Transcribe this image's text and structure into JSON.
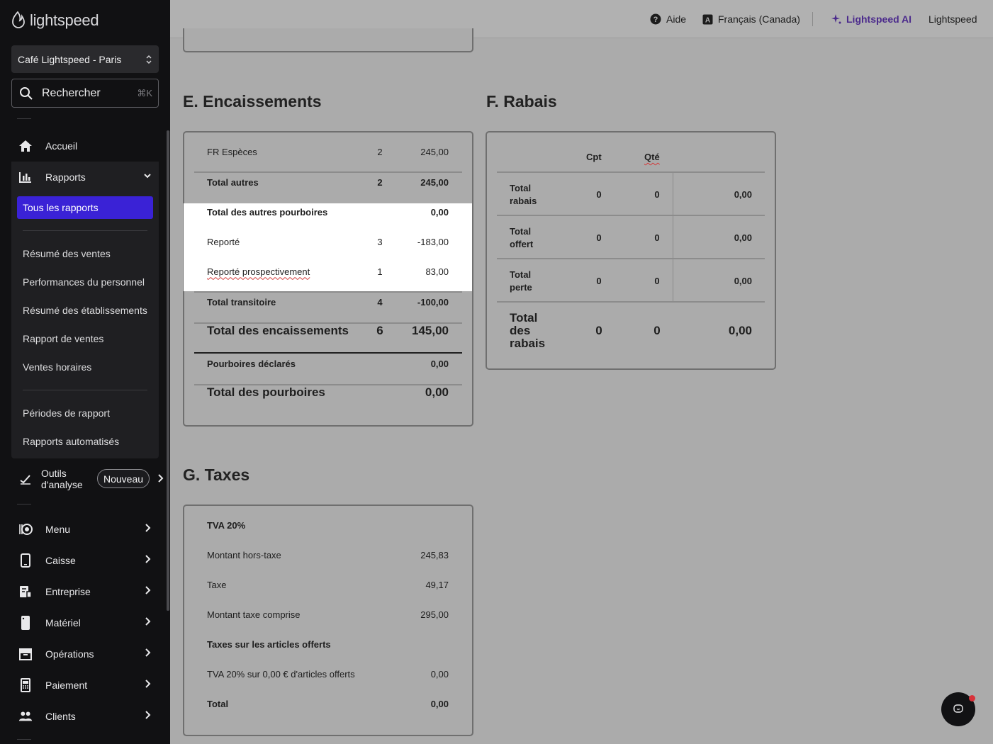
{
  "sidebar": {
    "logo_text": "lightspeed",
    "venue": "Café Lightspeed - Paris",
    "search": {
      "label": "Rechercher",
      "shortcut": "⌘K"
    },
    "nav": {
      "accueil": "Accueil",
      "rapports": "Rapports",
      "outils": "Outils d'analyse",
      "outils_badge": "Nouveau",
      "menu": "Menu",
      "caisse": "Caisse",
      "entreprise": "Entreprise",
      "materiel": "Matériel",
      "operations": "Opérations",
      "paiement": "Paiement",
      "clients": "Clients"
    },
    "reports_sub": {
      "active": "Tous les rapports",
      "items": [
        "Résumé des ventes",
        "Performances du personnel",
        "Résumé des établissements",
        "Rapport de ventes",
        "Ventes horaires"
      ],
      "items2": [
        "Périodes de rapport",
        "Rapports automatisés"
      ]
    }
  },
  "topbar": {
    "help": "Aide",
    "language": "Français (Canada)",
    "ai": "Lightspeed AI",
    "account": "Lightspeed"
  },
  "encaissements": {
    "title": "E. Encaissements",
    "rows": [
      {
        "label": "FR Espèces",
        "count": "2",
        "amount": "245,00"
      },
      {
        "label": "Total autres",
        "count": "2",
        "amount": "245,00"
      },
      {
        "label": "Total des autres pourboires",
        "count": "",
        "amount": "0,00"
      },
      {
        "label": "Reporté",
        "count": "3",
        "amount": "-183,00"
      },
      {
        "label": "Reporté prospectivement",
        "count": "1",
        "amount": "83,00"
      },
      {
        "label": "Total transitoire",
        "count": "4",
        "amount": "-100,00"
      },
      {
        "label": "Total des encaissements",
        "count": "6",
        "amount": "145,00"
      },
      {
        "label": "Pourboires déclarés",
        "count": "",
        "amount": "0,00"
      },
      {
        "label": "Total des pourboires",
        "count": "",
        "amount": "0,00"
      }
    ]
  },
  "rabais": {
    "title": "F. Rabais",
    "headers": {
      "cpt": "Cpt",
      "qte": "Qté"
    },
    "rows": [
      {
        "label_1": "Total",
        "label_2": "rabais",
        "label_3": "",
        "cpt": "0",
        "qte": "0",
        "amount": "0,00"
      },
      {
        "label_1": "Total",
        "label_2": "offert",
        "label_3": "",
        "cpt": "0",
        "qte": "0",
        "amount": "0,00"
      },
      {
        "label_1": "Total",
        "label_2": "perte",
        "label_3": "",
        "cpt": "0",
        "qte": "0",
        "amount": "0,00"
      },
      {
        "label_1": "Total",
        "label_2": "des",
        "label_3": "rabais",
        "cpt": "0",
        "qte": "0",
        "amount": "0,00"
      }
    ]
  },
  "taxes": {
    "title": "G. Taxes",
    "rows": [
      {
        "label": "TVA 20%",
        "amount": ""
      },
      {
        "label": "Montant hors-taxe",
        "amount": "245,83"
      },
      {
        "label": "Taxe",
        "amount": "49,17"
      },
      {
        "label": "Montant taxe comprise",
        "amount": "295,00"
      },
      {
        "label": "Taxes sur les articles offerts",
        "amount": ""
      },
      {
        "label": "TVA 20% sur 0,00 € d'articles offerts",
        "amount": "0,00"
      },
      {
        "label": "Total",
        "amount": "0,00"
      }
    ]
  },
  "colors": {
    "accent": "#3a22d6",
    "ai": "#4b2a8c",
    "notification": "#d8323a"
  }
}
